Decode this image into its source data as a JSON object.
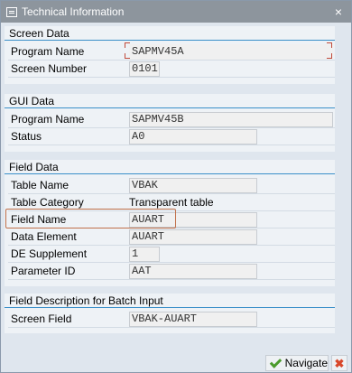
{
  "window": {
    "title": "Technical Information",
    "close_glyph": "×"
  },
  "screen_data": {
    "title": "Screen Data",
    "program_name_label": "Program Name",
    "program_name_value": "SAPMV45A",
    "screen_number_label": "Screen Number",
    "screen_number_value": "0101"
  },
  "gui_data": {
    "title": "GUI Data",
    "program_name_label": "Program Name",
    "program_name_value": "SAPMV45B",
    "status_label": "Status",
    "status_value": "A0"
  },
  "field_data": {
    "title": "Field Data",
    "table_name_label": "Table Name",
    "table_name_value": "VBAK",
    "table_category_label": "Table Category",
    "table_category_value": "Transparent table",
    "field_name_label": "Field Name",
    "field_name_value": "AUART",
    "data_element_label": "Data Element",
    "data_element_value": "AUART",
    "de_supplement_label": "DE Supplement",
    "de_supplement_value": "1",
    "parameter_id_label": "Parameter ID",
    "parameter_id_value": "AAT"
  },
  "batch_input": {
    "title": "Field Description for Batch Input",
    "screen_field_label": "Screen Field",
    "screen_field_value": "VBAK-AUART"
  },
  "footer": {
    "navigate_label": "Navigate",
    "cancel_glyph": "✖",
    "colors": {
      "ok": "#4a9b2c",
      "cancel": "#d8472a"
    }
  },
  "colors": {
    "section_rule": "#3a8fc9",
    "highlight": "#c0704a",
    "titlebar": "#8d959d"
  }
}
